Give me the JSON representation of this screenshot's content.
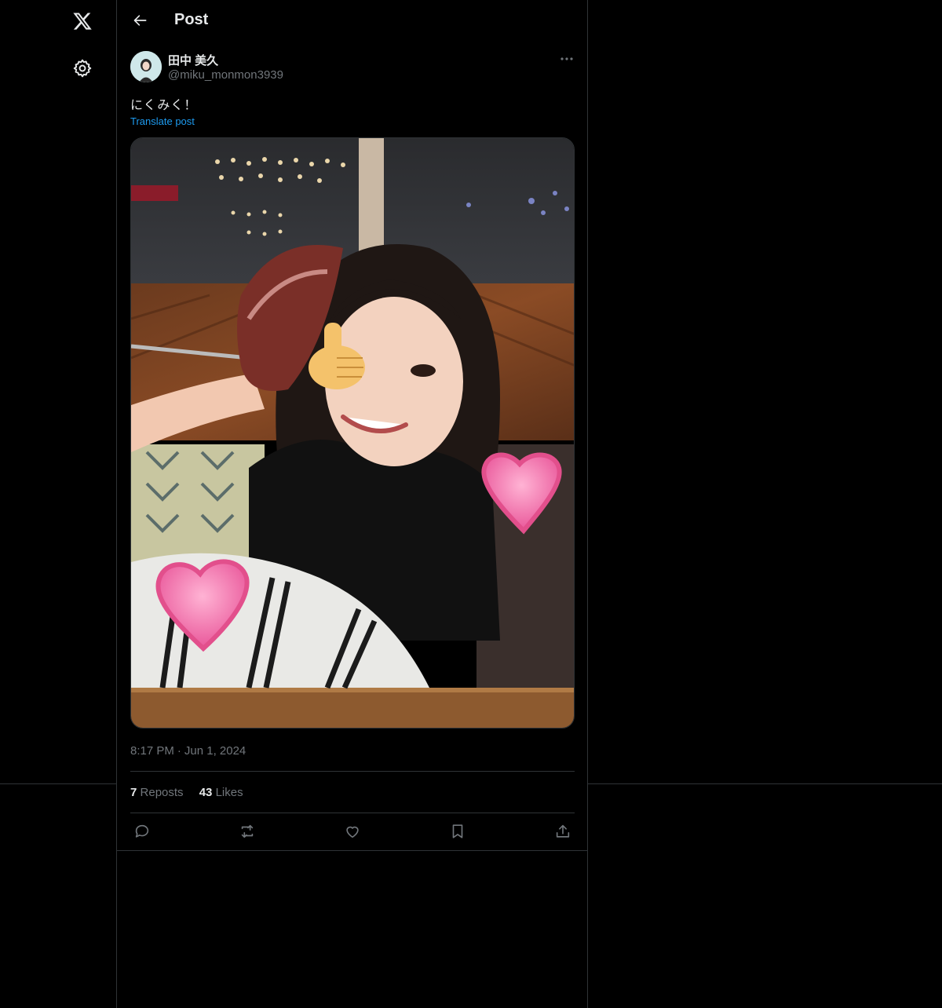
{
  "nav": {
    "logo_icon": "x-logo-icon",
    "settings_icon": "gear-icon"
  },
  "header": {
    "title": "Post",
    "back_icon": "arrow-left-icon"
  },
  "post": {
    "author_name": "田中 美久",
    "author_handle": "@miku_monmon3939",
    "text": "にくみく！",
    "translate_label": "Translate post",
    "time": "8:17 PM",
    "separator": "·",
    "date": "Jun 1, 2024"
  },
  "stats": {
    "reposts_count": "7",
    "reposts_label": "Reposts",
    "likes_count": "43",
    "likes_label": "Likes"
  },
  "actions": {
    "reply_icon": "reply-icon",
    "repost_icon": "repost-icon",
    "like_icon": "heart-icon",
    "bookmark_icon": "bookmark-icon",
    "share_icon": "share-icon"
  },
  "colors": {
    "background": "#000000",
    "text_primary": "#e7e9ea",
    "text_secondary": "#71767b",
    "link": "#1d9bf0",
    "border": "#2f3336"
  }
}
